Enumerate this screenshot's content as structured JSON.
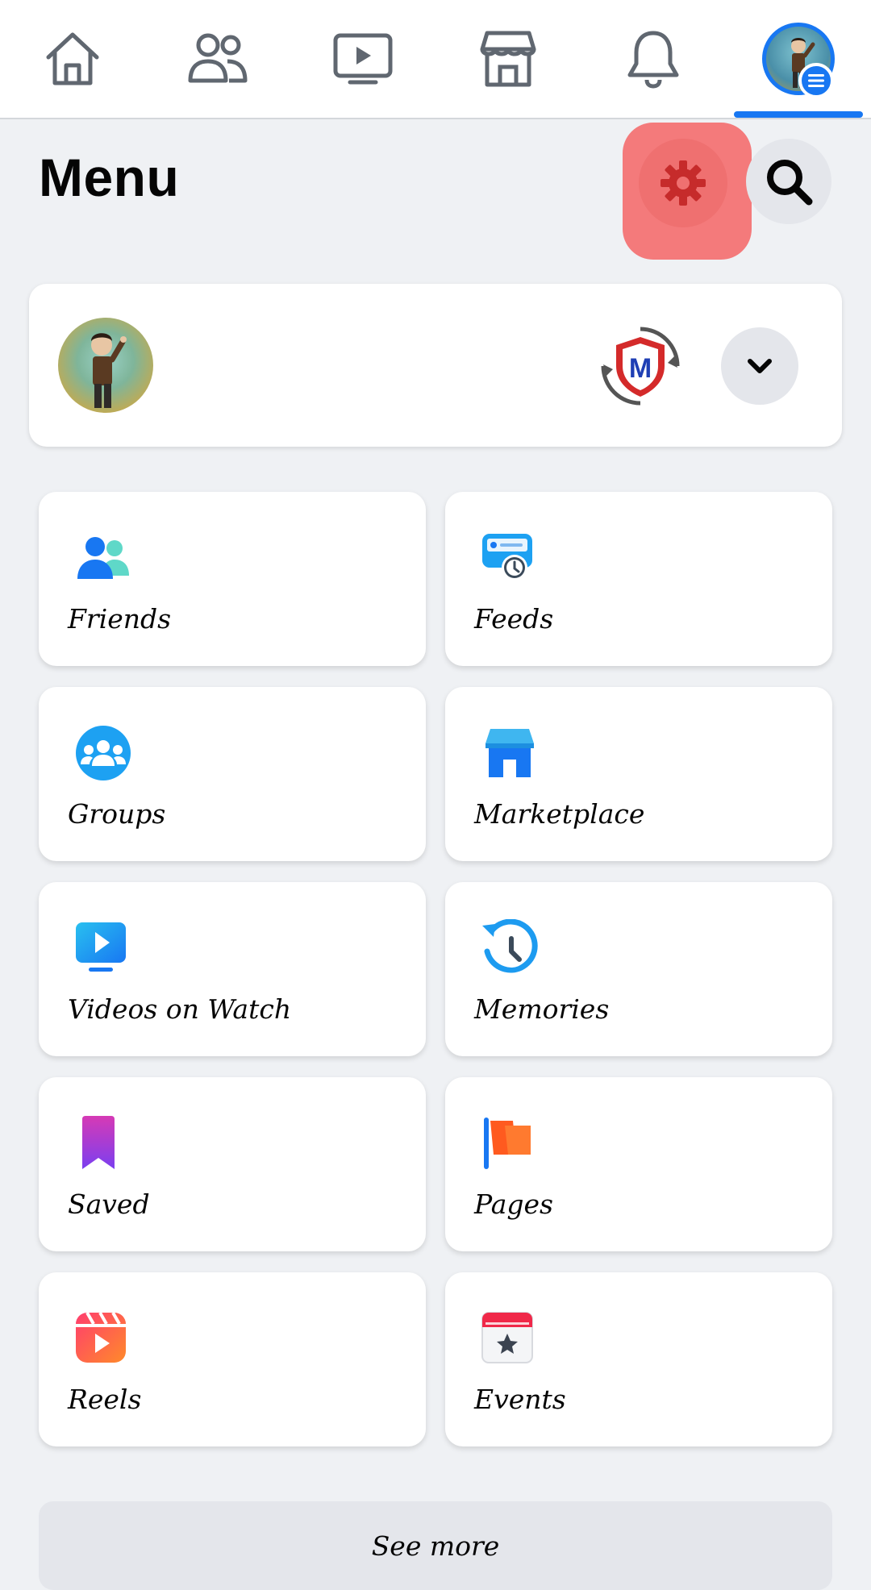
{
  "nav": {
    "items": [
      {
        "name": "home-icon"
      },
      {
        "name": "friends-icon"
      },
      {
        "name": "watch-icon"
      },
      {
        "name": "marketplace-icon"
      },
      {
        "name": "notifications-icon"
      },
      {
        "name": "profile-menu-icon"
      }
    ],
    "active_index": 5,
    "accent": "#1877f2"
  },
  "header": {
    "title": "Menu",
    "settings_icon": "gear-icon",
    "search_icon": "search-icon",
    "highlight_color": "#f47a7b"
  },
  "profile": {
    "avatar_icon": "avatar",
    "page_logo_letter": "M",
    "dropdown_icon": "chevron-down-icon"
  },
  "shortcuts": [
    {
      "label": "Friends",
      "icon": "friends-icon"
    },
    {
      "label": "Feeds",
      "icon": "feeds-icon"
    },
    {
      "label": "Groups",
      "icon": "groups-icon"
    },
    {
      "label": "Marketplace",
      "icon": "marketplace-icon"
    },
    {
      "label": "Videos on Watch",
      "icon": "watch-icon"
    },
    {
      "label": "Memories",
      "icon": "memories-icon"
    },
    {
      "label": "Saved",
      "icon": "saved-icon"
    },
    {
      "label": "Pages",
      "icon": "pages-icon"
    },
    {
      "label": "Reels",
      "icon": "reels-icon"
    },
    {
      "label": "Events",
      "icon": "events-icon"
    }
  ],
  "see_more": {
    "label": "See more"
  }
}
